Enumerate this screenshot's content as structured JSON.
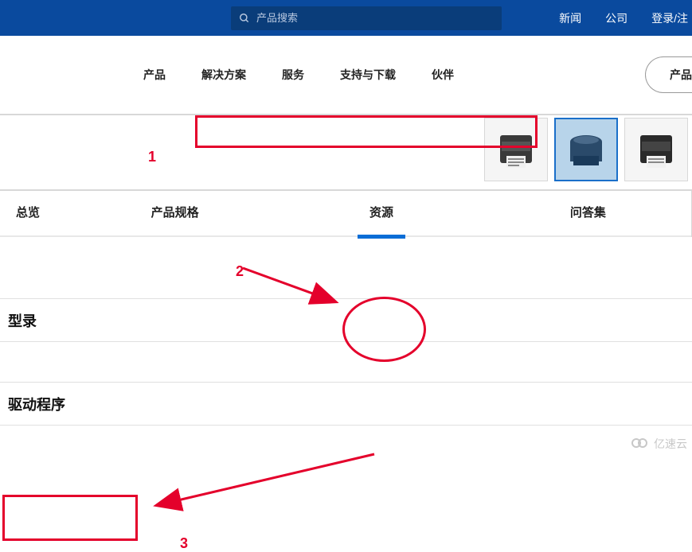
{
  "topbar": {
    "search_placeholder": "产品搜索",
    "links": [
      "新闻",
      "公司",
      "登录/注"
    ]
  },
  "navbar": {
    "items": [
      "产品",
      "解决方案",
      "服务",
      "支持与下载",
      "伙伴"
    ],
    "right_button": "产品"
  },
  "thumbnails": {
    "count": 3,
    "selected_index": 1
  },
  "tabs": {
    "items": [
      "总览",
      "产品规格",
      "资源",
      "问答集"
    ],
    "active_index": 2
  },
  "sections": {
    "catalog": "型录",
    "driver": "驱动程序"
  },
  "annotations": {
    "num1": "1",
    "num2": "2",
    "num3": "3"
  },
  "watermark": "亿速云"
}
